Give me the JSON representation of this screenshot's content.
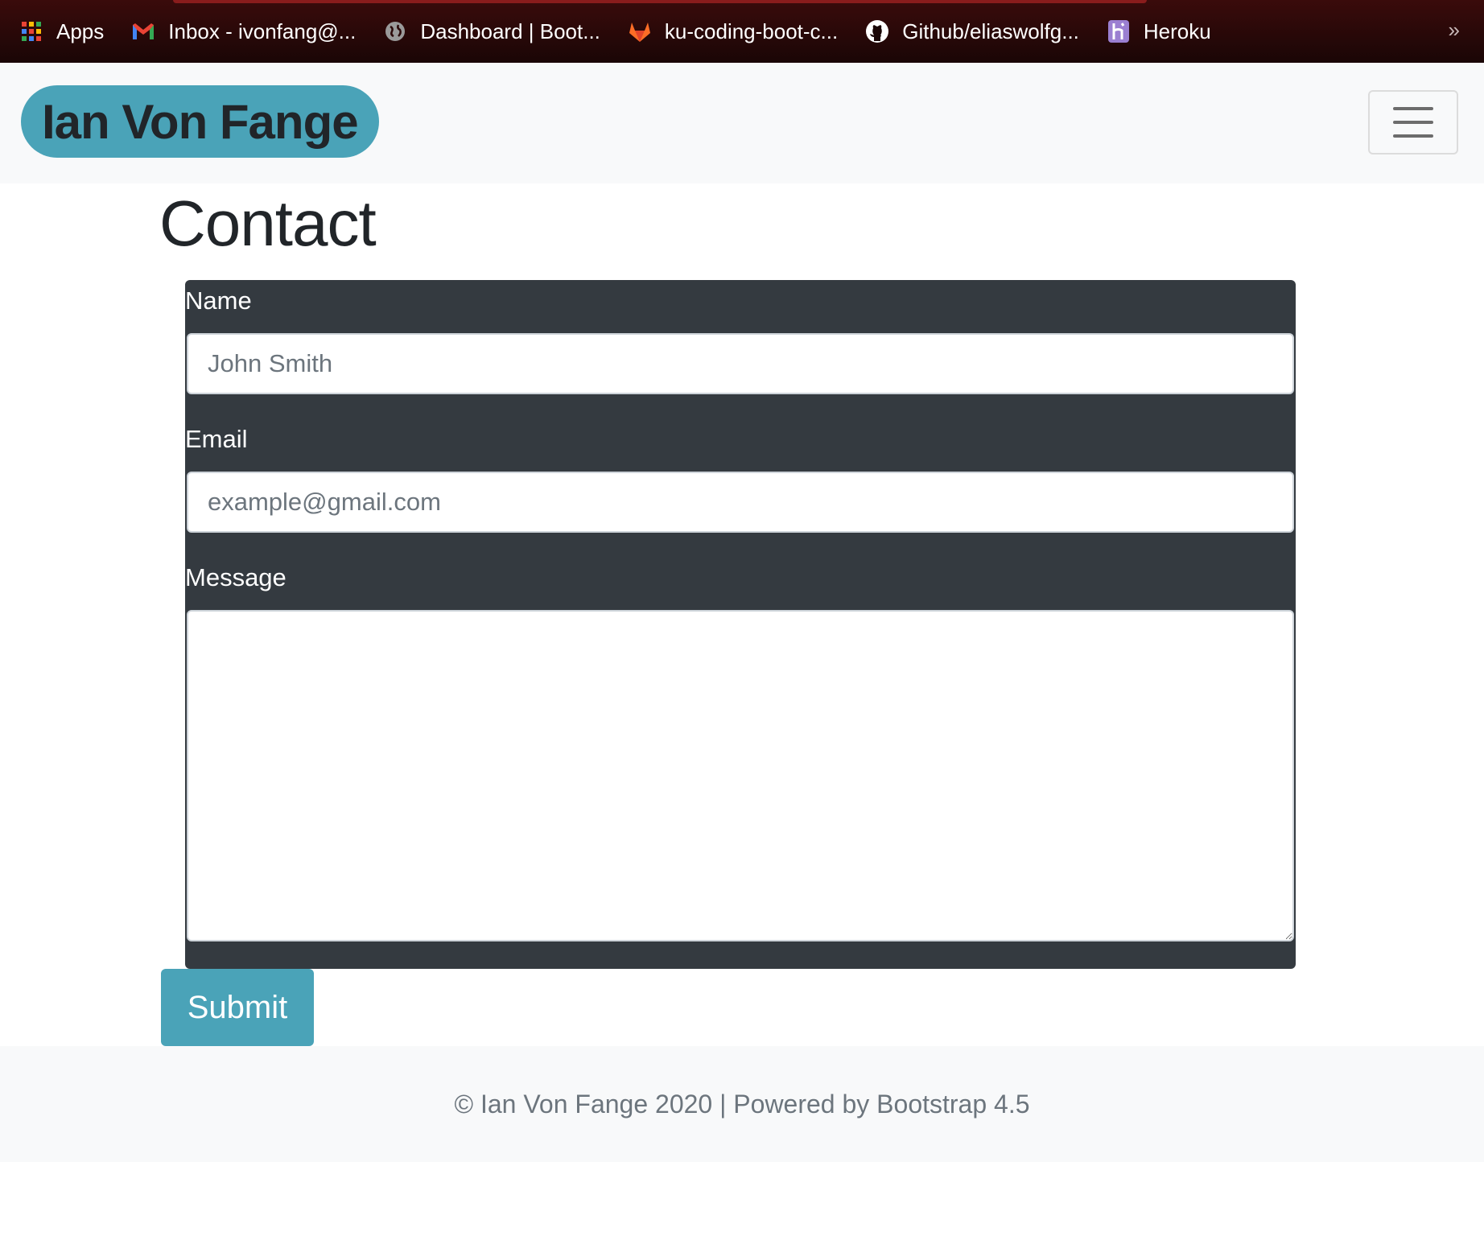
{
  "bookmarks": [
    {
      "label": "Apps",
      "icon": "apps-grid-icon"
    },
    {
      "label": "Inbox - ivonfang@...",
      "icon": "gmail-icon"
    },
    {
      "label": "Dashboard | Boot...",
      "icon": "globe-icon"
    },
    {
      "label": "ku-coding-boot-c...",
      "icon": "gitlab-icon"
    },
    {
      "label": "Github/eliaswolfg...",
      "icon": "github-icon"
    },
    {
      "label": "Heroku",
      "icon": "heroku-icon"
    }
  ],
  "bookmarks_more": "»",
  "navbar": {
    "brand": "Ian Von Fange",
    "toggler_icon": "hamburger-icon"
  },
  "page": {
    "title": "Contact"
  },
  "form": {
    "name_label": "Name",
    "name_placeholder": "John Smith",
    "email_label": "Email",
    "email_placeholder": "example@gmail.com",
    "message_label": "Message",
    "message_value": "",
    "submit_label": "Submit"
  },
  "footer": {
    "text": "© Ian Von Fange 2020 | Powered by Bootstrap 4.5"
  },
  "colors": {
    "accent": "#4aa3b8",
    "form_bg": "#343a40",
    "navbar_bg": "#f8f9fa",
    "bookmarks_bg": "#2a0909"
  }
}
